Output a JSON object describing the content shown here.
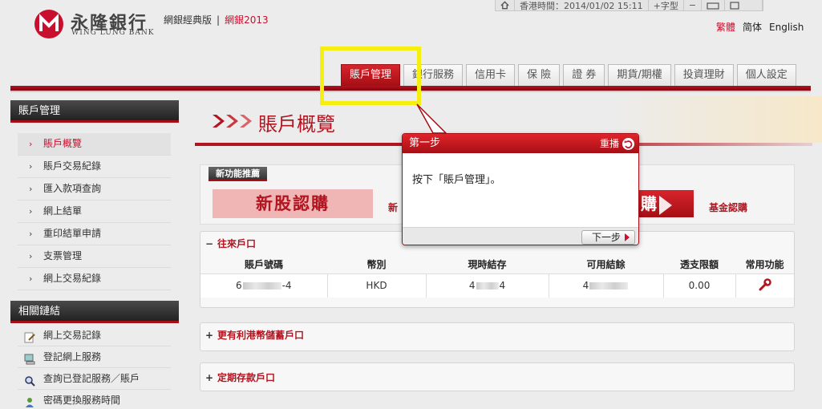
{
  "header": {
    "logo_cn": "永隆銀行",
    "logo_en": "WING LUNG BANK",
    "classic_link": "網銀經典版",
    "separator": "|",
    "new_link": "網銀2013"
  },
  "topbar": {
    "time_label": "香港時間：2014/01/02 15:11",
    "font_size_label": "+字型",
    "font_minus": "−"
  },
  "language": {
    "traditional": "繁體",
    "simplified": "简体",
    "english": "English"
  },
  "tabs": [
    {
      "label": "賬戶管理"
    },
    {
      "label": "銀行服務"
    },
    {
      "label": "信用卡"
    },
    {
      "label": "保 險"
    },
    {
      "label": "證 券"
    },
    {
      "label": "期貨/期權"
    },
    {
      "label": "投資理財"
    },
    {
      "label": "個人設定"
    }
  ],
  "sidebar": {
    "title": "賬戶管理",
    "items": [
      {
        "label": "賬戶概覽"
      },
      {
        "label": "賬戶交易紀錄"
      },
      {
        "label": "匯入款項查詢"
      },
      {
        "label": "網上結單"
      },
      {
        "label": "重印結單申請"
      },
      {
        "label": "支票管理"
      },
      {
        "label": "網上交易紀錄"
      }
    ],
    "links_title": "相關鏈結",
    "links": [
      {
        "label": "網上交易記錄",
        "icon": "document-pencil-icon"
      },
      {
        "label": "登記網上服務",
        "icon": "computer-icon"
      },
      {
        "label": "查詢已登記服務／賬戶",
        "icon": "magnifier-icon"
      },
      {
        "label": "密碼更換服務時間",
        "icon": "user-key-icon"
      }
    ]
  },
  "main": {
    "page_title": "賬戶概覽",
    "feature_tag": "新功能推薦",
    "banner_ipo": "新股認購",
    "banner_partial": "新",
    "banner_fund": "購",
    "fund_link": "基金認購",
    "accounts_section": {
      "title": "往來戶口",
      "sign": "−",
      "columns": [
        "賬戶號碼",
        "幣別",
        "現時結存",
        "可用結餘",
        "透支限額",
        "常用功能"
      ],
      "row": {
        "account_prefix": "6",
        "account_suffix": "-4",
        "currency": "HKD",
        "balance_prefix": "4",
        "balance_suffix": "4",
        "available_prefix": "4",
        "overdraft": "0.00"
      }
    },
    "savings_section": {
      "title": "更有利港幣儲蓄戶口",
      "sign": "+"
    },
    "deposit_section": {
      "title": "定期存款戶口",
      "sign": "+"
    }
  },
  "dialog": {
    "title": "第一步",
    "replay": "重播",
    "body": "按下「賬戶管理」。",
    "next": "下一步"
  },
  "colors": {
    "brand_red": "#c8102e",
    "highlight_yellow": "#f4ee11"
  }
}
